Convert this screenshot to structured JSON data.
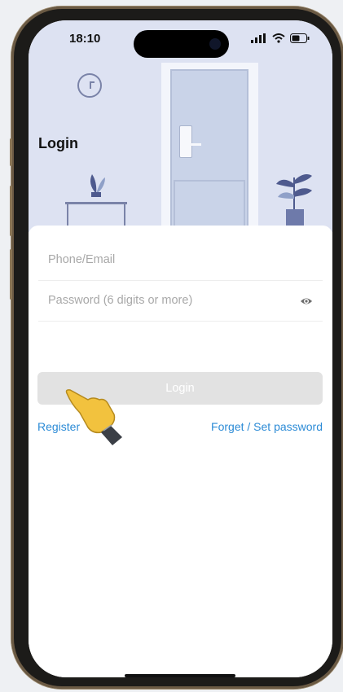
{
  "status": {
    "time": "18:10"
  },
  "header": {
    "title": "Login"
  },
  "form": {
    "phone_placeholder": "Phone/Email",
    "password_placeholder": "Password (6 digits or more)",
    "login_label": "Login",
    "register_label": "Register",
    "forget_label": "Forget / Set password"
  },
  "colors": {
    "accent": "#2c8bd6",
    "hero_bg": "#dde2f2",
    "button_disabled": "#e2e2e2"
  }
}
